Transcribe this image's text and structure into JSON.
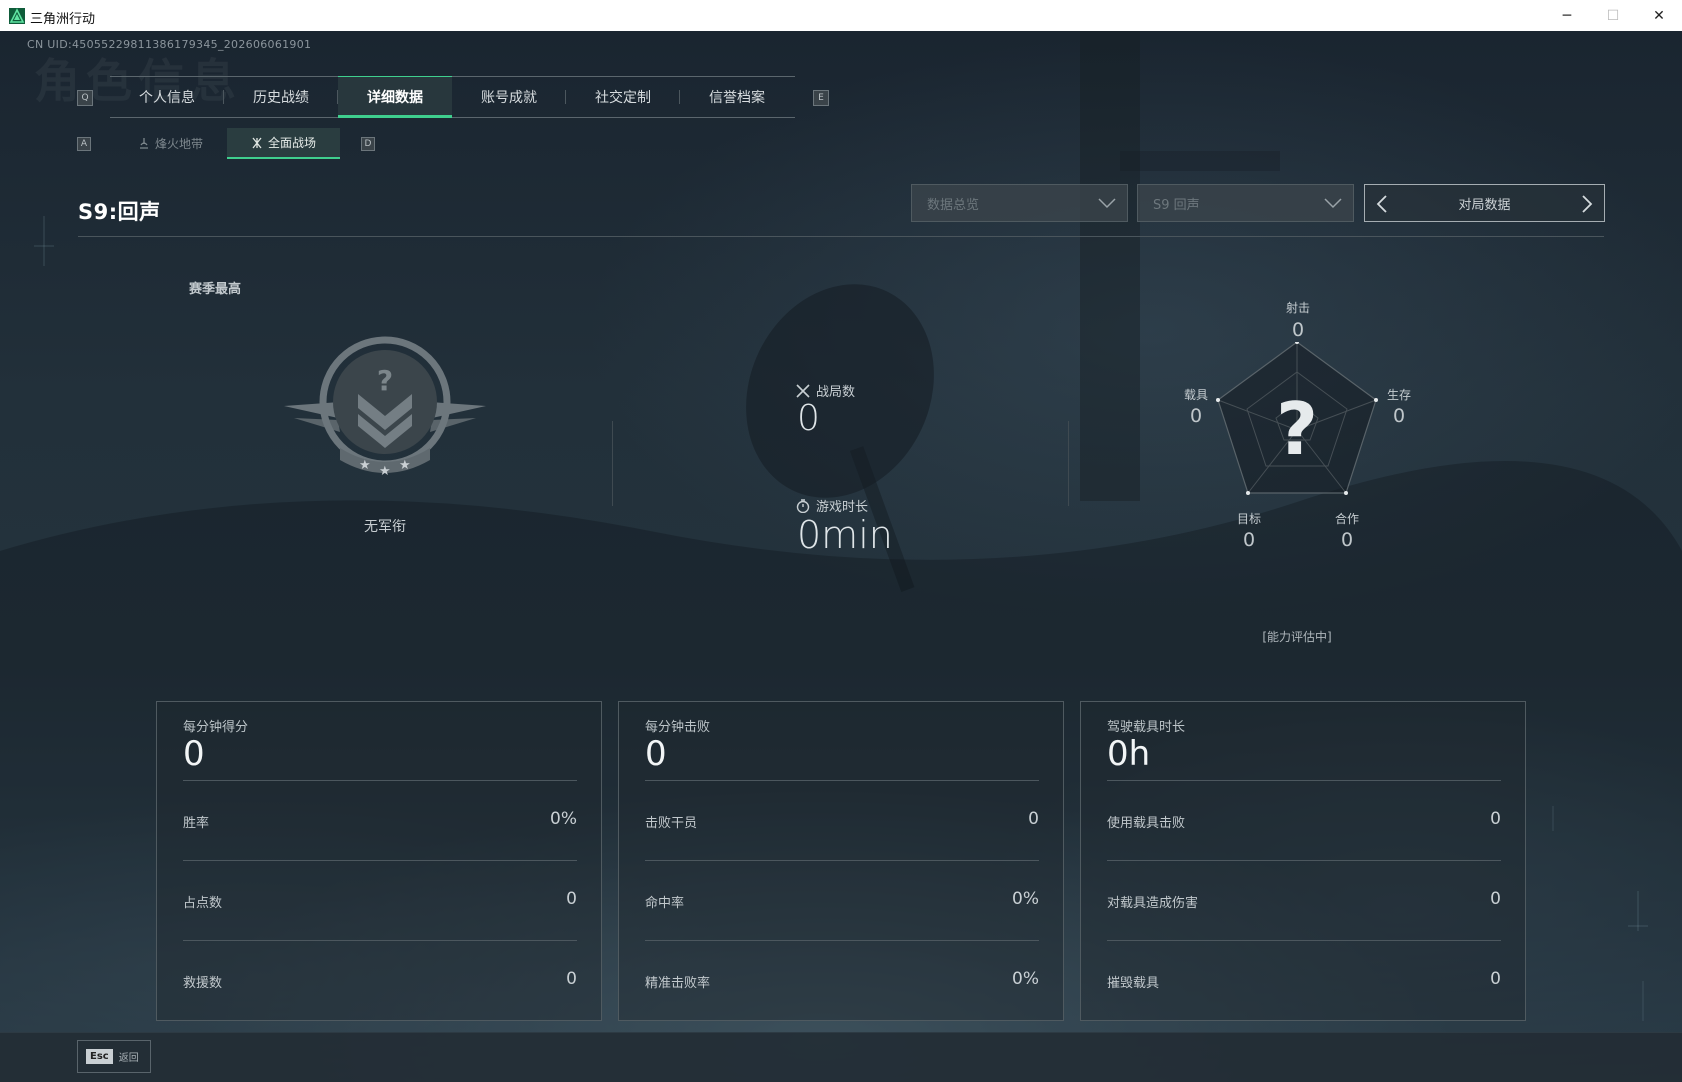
{
  "window": {
    "title": "三角洲行动",
    "minimize": "─",
    "maximize": "☐",
    "close": "✕"
  },
  "uid": "CN UID:45055229811386179345_202606061901",
  "watermark": "角色信息",
  "tabs": {
    "prev_key": "Q",
    "next_key": "E",
    "items": [
      "个人信息",
      "历史战绩",
      "详细数据",
      "账号成就",
      "社交定制",
      "信誉档案"
    ],
    "active_index": 2
  },
  "subtabs": {
    "prev_key": "A",
    "next_key": "D",
    "items": [
      "烽火地带",
      "全面战场"
    ],
    "active_index": 1
  },
  "season": {
    "title": "S9:回声",
    "filter_type": "数据总览",
    "filter_season": "S9 回声",
    "pager_label": "对局数据"
  },
  "rank": {
    "section_label": "赛季最高",
    "name": "无军衔"
  },
  "summary": {
    "matches_label": "战局数",
    "matches_value": "0",
    "playtime_label": "游戏时长",
    "playtime_value": "0min"
  },
  "radar": {
    "center_mark": "?",
    "axes": [
      {
        "label": "射击",
        "value": "0"
      },
      {
        "label": "生存",
        "value": "0"
      },
      {
        "label": "合作",
        "value": "0"
      },
      {
        "label": "目标",
        "value": "0"
      },
      {
        "label": "载具",
        "value": "0"
      }
    ],
    "status": "[能力评估中]"
  },
  "panels": [
    {
      "head_label": "每分钟得分",
      "head_value": "0",
      "rows": [
        {
          "label": "胜率",
          "value": "0%"
        },
        {
          "label": "占点数",
          "value": "0"
        },
        {
          "label": "救援数",
          "value": "0"
        }
      ]
    },
    {
      "head_label": "每分钟击败",
      "head_value": "0",
      "rows": [
        {
          "label": "击败干员",
          "value": "0"
        },
        {
          "label": "命中率",
          "value": "0%"
        },
        {
          "label": "精准击败率",
          "value": "0%"
        }
      ]
    },
    {
      "head_label": "驾驶载具时长",
      "head_value": "0h",
      "rows": [
        {
          "label": "使用载具击败",
          "value": "0"
        },
        {
          "label": "对载具造成伤害",
          "value": "0"
        },
        {
          "label": "摧毁载具",
          "value": "0"
        }
      ]
    }
  ],
  "footer": {
    "esc_key": "Esc",
    "back_label": "返回"
  },
  "colors": {
    "accent": "#3fcf8e",
    "background": "#1c2730",
    "panel_border": "#4f5a60"
  }
}
